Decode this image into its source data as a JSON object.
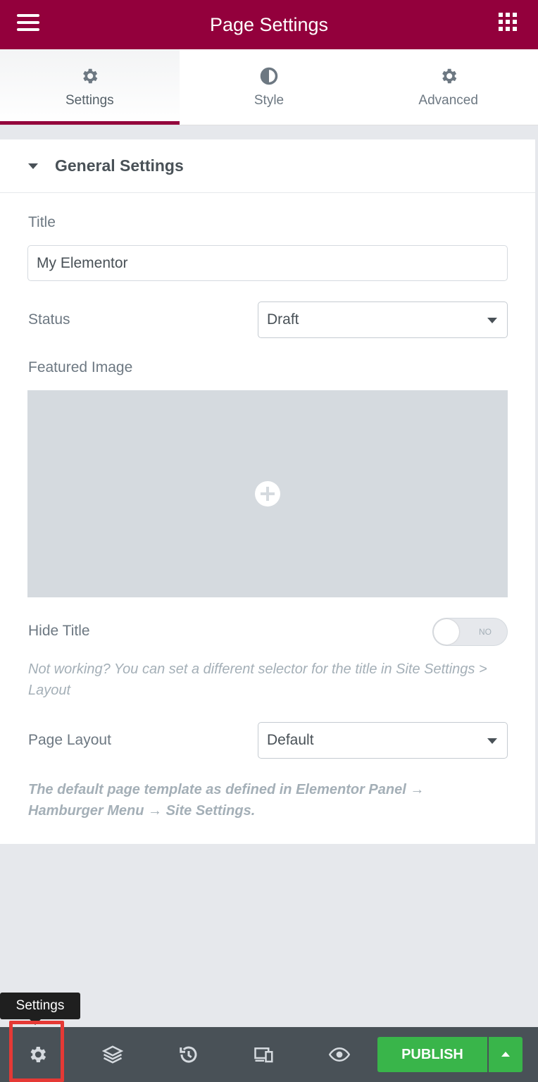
{
  "header": {
    "title": "Page Settings",
    "menu_icon": "hamburger-icon",
    "apps_icon": "grid-icon",
    "brand_color": "#93003c"
  },
  "tabs": [
    {
      "label": "Settings",
      "icon": "gear-icon",
      "active": true
    },
    {
      "label": "Style",
      "icon": "half-circle-icon",
      "active": false
    },
    {
      "label": "Advanced",
      "icon": "gear-icon",
      "active": false
    }
  ],
  "section": {
    "title": "General Settings",
    "expanded": true
  },
  "fields": {
    "title_label": "Title",
    "title_value": "My Elementor",
    "status_label": "Status",
    "status_value": "Draft",
    "featured_image_label": "Featured Image",
    "hide_title_label": "Hide Title",
    "hide_title_toggle": "NO",
    "hide_title_note": "Not working? You can set a different selector for the title in Site Settings > Layout",
    "page_layout_label": "Page Layout",
    "page_layout_value": "Default",
    "page_layout_note": "The default page template as defined in Elementor Panel → Hamburger Menu → Site Settings."
  },
  "tooltip": {
    "text": "Settings"
  },
  "footer": {
    "icons": [
      "gear-icon",
      "layers-icon",
      "history-icon",
      "responsive-icon",
      "eye-icon"
    ],
    "publish_label": "PUBLISH",
    "publish_color": "#39b54a",
    "highlight_color": "#e53935"
  }
}
